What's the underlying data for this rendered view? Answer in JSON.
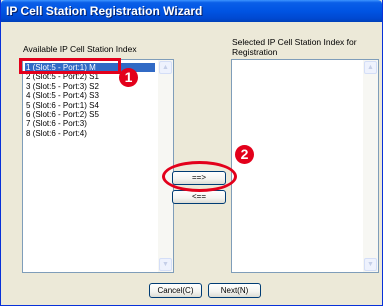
{
  "window": {
    "title": "IP Cell Station Registration Wizard"
  },
  "available": {
    "label": "Available IP Cell Station Index",
    "items": [
      "1 (Slot:5 - Port:1)  M",
      "2 (Slot:5 - Port:2)  S1",
      "3 (Slot:5 - Port:3)  S2",
      "4 (Slot:5 - Port:4)  S3",
      "5 (Slot:6 - Port:1)  S4",
      "6 (Slot:6 - Port:2)  S5",
      "7 (Slot:6 - Port:3)",
      "8 (Slot:6 - Port:4)"
    ],
    "selected_item": "1 (Slot:5 - Port:1)  M"
  },
  "selected": {
    "label_line1": "Selected IP Cell Station Index for",
    "label_line2": "Registration",
    "items": []
  },
  "buttons": {
    "add": "==>",
    "remove": "<==",
    "cancel": "Cancel(C)",
    "next": "Next(N)"
  },
  "annotations": {
    "marker_1": "1",
    "marker_2": "2",
    "highlight_color": "#E3001B"
  },
  "colors": {
    "titlebar": "#0054E3",
    "dialog_bg": "#ECE9D8",
    "selection": "#316AC5"
  },
  "icons": {
    "scroll_up": "up-arrow-icon",
    "scroll_down": "down-arrow-icon"
  }
}
